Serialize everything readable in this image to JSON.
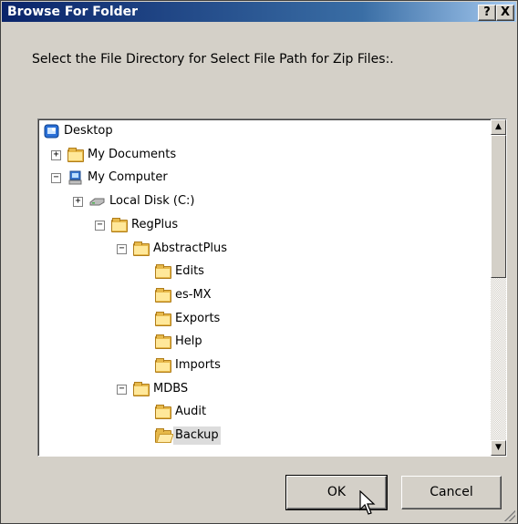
{
  "dialog": {
    "title": "Browse For Folder",
    "help_label": "?",
    "close_label": "X",
    "prompt": "Select the File Directory for Select File Path for Zip Files:."
  },
  "tree": {
    "items": [
      {
        "label": "Desktop",
        "icon": "desktop-icon",
        "expander": ""
      },
      {
        "label": "My Documents",
        "icon": "documents-folder-icon",
        "expander": "+"
      },
      {
        "label": "My Computer",
        "icon": "computer-icon",
        "expander": "−"
      },
      {
        "label": "Local Disk (C:)",
        "icon": "disk-drive-icon",
        "expander": "+"
      },
      {
        "label": "RegPlus",
        "icon": "folder-icon",
        "expander": "−"
      },
      {
        "label": "AbstractPlus",
        "icon": "folder-icon",
        "expander": "−"
      },
      {
        "label": "Edits",
        "icon": "folder-icon",
        "expander": ""
      },
      {
        "label": "es-MX",
        "icon": "folder-icon",
        "expander": ""
      },
      {
        "label": "Exports",
        "icon": "folder-icon",
        "expander": ""
      },
      {
        "label": "Help",
        "icon": "folder-icon",
        "expander": ""
      },
      {
        "label": "Imports",
        "icon": "folder-icon",
        "expander": ""
      },
      {
        "label": "MDBS",
        "icon": "folder-icon",
        "expander": "−"
      },
      {
        "label": "Audit",
        "icon": "folder-icon",
        "expander": ""
      },
      {
        "label": "Backup",
        "icon": "open-folder-icon",
        "expander": "",
        "selected": true
      }
    ]
  },
  "buttons": {
    "ok": "OK",
    "cancel": "Cancel"
  },
  "colors": {
    "titlebar": "#0a246a",
    "dialog_bg": "#d4d0c8",
    "folder": "#e6b84a"
  }
}
